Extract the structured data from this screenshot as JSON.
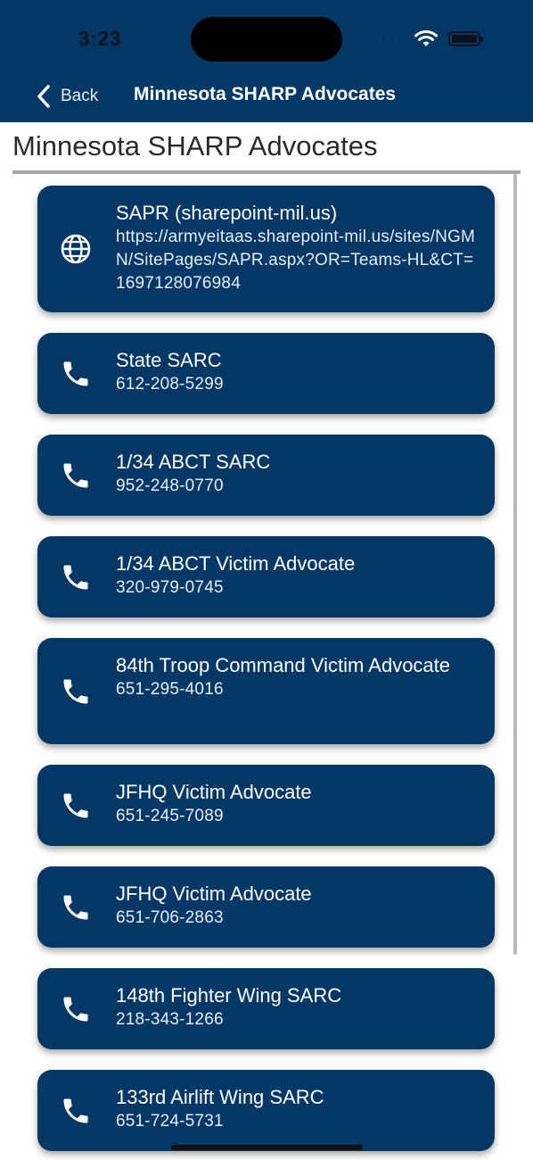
{
  "status_bar": {
    "time": "3:23"
  },
  "nav": {
    "back_label": "Back",
    "title": "Minnesota SHARP Advocates"
  },
  "page": {
    "heading": "Minnesota SHARP Advocates"
  },
  "contacts": [
    {
      "icon": "globe-icon",
      "title": "SAPR (sharepoint-mil.us)",
      "detail": "https://armyeitaas.sharepoint-mil.us/sites/NGMN/SitePages/SAPR.aspx?OR=Teams-HL&CT=1697128076984"
    },
    {
      "icon": "phone-icon",
      "title": "State SARC",
      "detail": "612-208-5299"
    },
    {
      "icon": "phone-icon",
      "title": "1/34 ABCT SARC",
      "detail": "952-248-0770"
    },
    {
      "icon": "phone-icon",
      "title": "1/34 ABCT Victim Advocate",
      "detail": "320-979-0745"
    },
    {
      "icon": "phone-icon",
      "title": "84th Troop Command Victim Advocate",
      "detail": "651-295-4016"
    },
    {
      "icon": "phone-icon",
      "title": "JFHQ Victim Advocate",
      "detail": "651-245-7089"
    },
    {
      "icon": "phone-icon",
      "title": "JFHQ Victim Advocate",
      "detail": "651-706-2863"
    },
    {
      "icon": "phone-icon",
      "title": "148th Fighter Wing SARC",
      "detail": "218-343-1266"
    },
    {
      "icon": "phone-icon",
      "title": "133rd Airlift Wing SARC",
      "detail": "651-724-5731"
    }
  ]
}
